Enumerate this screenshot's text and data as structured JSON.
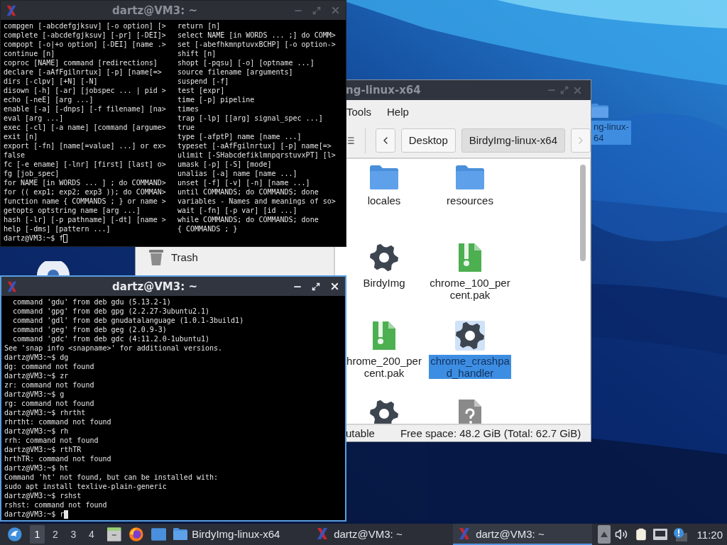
{
  "desktop": {
    "icons": [
      {
        "lines": [
          "ng-linux-",
          "64"
        ],
        "selected": true
      }
    ]
  },
  "file_manager": {
    "title": "ng-linux-x64",
    "menu": [
      "Tools",
      "Help"
    ],
    "nav": {
      "back_disabled": false,
      "forward_disabled": true
    },
    "path": [
      {
        "label": "Desktop",
        "selected": false
      },
      {
        "label": "BirdyImg-linux-x64",
        "selected": true
      }
    ],
    "sidebar": [
      {
        "label": "Trash"
      }
    ],
    "items": [
      {
        "kind": "folder",
        "lines": [
          "locales"
        ],
        "selected": false
      },
      {
        "kind": "folder",
        "lines": [
          "resources"
        ],
        "selected": false
      },
      {
        "kind": "executable",
        "lines": [
          "BirdyImg"
        ],
        "selected": false
      },
      {
        "kind": "archive",
        "lines": [
          "chrome_100_per",
          "cent.pak"
        ],
        "selected": false
      },
      {
        "kind": "archive",
        "lines": [
          "hrome_200_per",
          "cent.pak"
        ],
        "selected": false
      },
      {
        "kind": "executable",
        "lines": [
          "chrome_crashpa",
          "d_handler"
        ],
        "selected": true
      },
      {
        "kind": "executable",
        "selected": false
      },
      {
        "kind": "unknown",
        "selected": false
      }
    ],
    "status_left": "utable",
    "status_right": "Free space: 48.2 GiB (Total: 62.7 GiB)"
  },
  "terminals": [
    {
      "title": "dartz@VM3: ~",
      "active": false,
      "columns": [
        [
          "compgen [-abcdefgjksuv] [-o option] [>",
          "complete [-abcdefgjksuv] [-pr] [-DEI]>",
          "compopt [-o|+o option] [-DEI] [name .>",
          "continue [n]",
          "coproc [NAME] command [redirections]",
          "declare [-aAfFgilnrtux] [-p] [name[=>",
          "dirs [-clpv] [+N] [-N]",
          "disown [-h] [-ar] [jobspec ... | pid >",
          "echo [-neE] [arg ...]",
          "enable [-a] [-dnps] [-f filename] [na>",
          "eval [arg ...]",
          "exec [-cl] [-a name] [command [argume>",
          "exit [n]",
          "export [-fn] [name[=value] ...] or ex>",
          "false",
          "fc [-e ename] [-lnr] [first] [last] o>",
          "fg [job_spec]",
          "for NAME [in WORDS ... ] ; do COMMAND>",
          "for (( exp1; exp2; exp3 )); do COMMAN>",
          "function name { COMMANDS ; } or name >",
          "getopts optstring name [arg ...]",
          "hash [-lr] [-p pathname] [-dt] [name >",
          "help [-dms] [pattern ...]"
        ],
        [
          "return [n]",
          "select NAME [in WORDS ... ;] do COMM>",
          "set [-abefhkmnptuvxBCHP] [-o option->",
          "shift [n]",
          "shopt [-pqsu] [-o] [optname ...]",
          "source filename [arguments]",
          "suspend [-f]",
          "test [expr]",
          "time [-p] pipeline",
          "times",
          "trap [-lp] [[arg] signal_spec ...]",
          "true",
          "type [-afptP] name [name ...]",
          "typeset [-aAfFgilnrtux] [-p] name[=>",
          "ulimit [-SHabcdefiklmnpqrstuvxPT] [l>",
          "umask [-p] [-S] [mode]",
          "unalias [-a] name [name ...]",
          "unset [-f] [-v] [-n] [name ...]",
          "until COMMANDS; do COMMANDS; done",
          "variables - Names and meanings of so>",
          "wait [-fn] [-p var] [id ...]",
          "while COMMANDS; do COMMANDS; done",
          "{ COMMANDS ; }"
        ]
      ],
      "prompt": "dartz@VM3:~$ f"
    },
    {
      "title": "dartz@VM3: ~",
      "active": true,
      "lines": [
        "  command 'gdu' from deb gdu (5.13.2-1)",
        "  command 'gpg' from deb gpg (2.2.27-3ubuntu2.1)",
        "  command 'gdl' from deb gnudatalanguage (1.0.1-3build1)",
        "  command 'geg' from deb geg (2.0.9-3)",
        "  command 'gdc' from deb gdc (4:11.2.0-1ubuntu1)",
        "See 'snap info <snapname>' for additional versions.",
        "dartz@VM3:~$ dg",
        "dg: command not found",
        "dartz@VM3:~$ zr",
        "zr: command not found",
        "dartz@VM3:~$ g",
        "rg: command not found",
        "dartz@VM3:~$ rhrtht",
        "rhrtht: command not found",
        "dartz@VM3:~$ rh",
        "rrh: command not found",
        "dartz@VM3:~$ rthTR",
        "hrthTR: command not found",
        "dartz@VM3:~$ ht",
        "Command 'ht' not found, but can be installed with:",
        "sudo apt install texlive-plain-generic",
        "dartz@VM3:~$ rshst",
        "rshst: command not found"
      ],
      "prompt": "dartz@VM3:~$ r"
    }
  ],
  "taskbar": {
    "workspaces": [
      {
        "label": "1",
        "selected": true
      },
      {
        "label": "2",
        "selected": false
      },
      {
        "label": "3",
        "selected": false
      },
      {
        "label": "4",
        "selected": false
      }
    ],
    "tasks": [
      {
        "kind": "folder",
        "label": "BirdyImg-linux-x64",
        "selected": false
      },
      {
        "kind": "terminal",
        "label": "dartz@VM3: ~",
        "selected": false
      },
      {
        "kind": "terminal",
        "label": "dartz@VM3: ~",
        "selected": true
      }
    ],
    "clock": "11:20"
  }
}
